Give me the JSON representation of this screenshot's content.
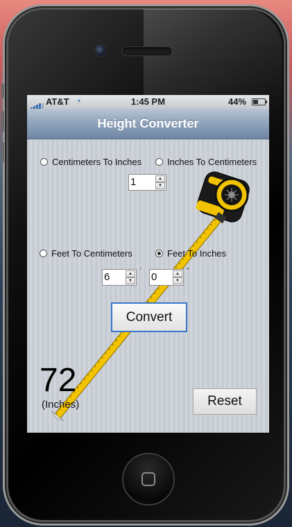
{
  "status_bar": {
    "carrier": "AT&T",
    "time": "1:45 PM",
    "battery": "44%",
    "battery_level": 0.44
  },
  "nav": {
    "title": "Height Converter"
  },
  "options": {
    "cm_to_in": {
      "label": "Centimeters To Inches",
      "selected": false
    },
    "in_to_cm": {
      "label": "Inches To Centimeters",
      "selected": false
    },
    "ft_to_cm": {
      "label": "Feet To Centimeters",
      "selected": false
    },
    "ft_to_in": {
      "label": "Feet To Inches",
      "selected": true
    }
  },
  "inputs": {
    "single_value": "1",
    "feet_value": "6",
    "inches_value": "0",
    "feet_mark": "'",
    "inches_mark": "\""
  },
  "buttons": {
    "convert": "Convert",
    "reset": "Reset"
  },
  "result": {
    "value": "72",
    "unit": "(Inches)"
  },
  "colors": {
    "accent": "#3a78c9",
    "tape_yellow": "#f2c300",
    "nav_bar": "#8ea2ba"
  }
}
